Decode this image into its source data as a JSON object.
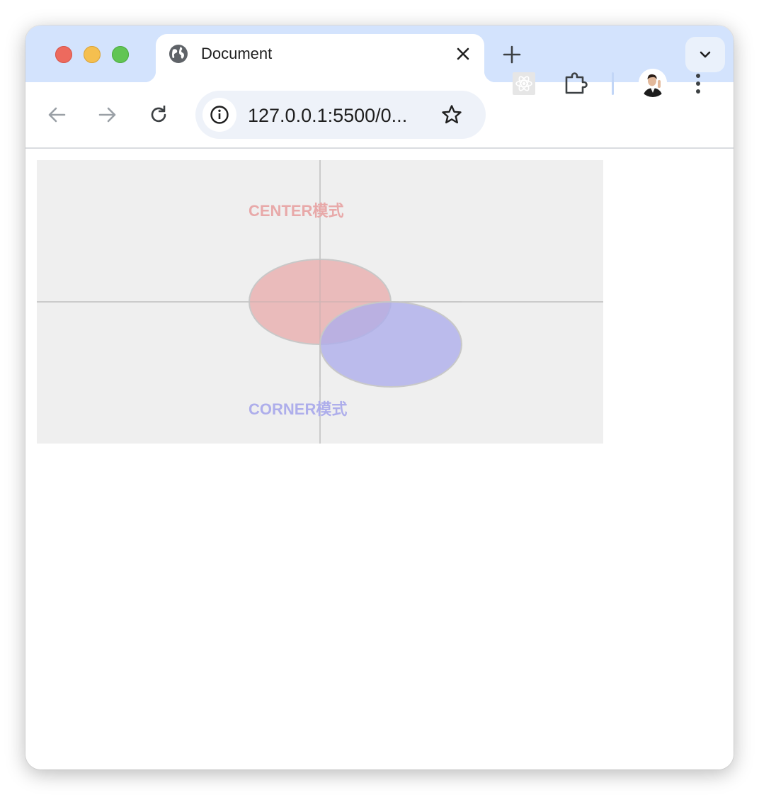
{
  "tab": {
    "title": "Document",
    "favicon": "globe-icon",
    "close_icon": "close-icon"
  },
  "toolbar": {
    "url": "127.0.0.1:5500/0...",
    "icons": [
      "back-arrow-icon",
      "forward-arrow-icon",
      "reload-icon",
      "site-info-icon",
      "bookmark-star-icon",
      "react-devtools-icon",
      "extensions-puzzle-icon",
      "profile-avatar",
      "more-menu-icon"
    ]
  },
  "canvas": {
    "background": "#efefef",
    "axis_color": "#bfbfbf",
    "center_label": "CENTER模式",
    "corner_label": "CORNER模式",
    "center_color": "#e8a9a9",
    "corner_color": "#aeaeeb",
    "ellipse_stroke": "#c8c8c8"
  }
}
